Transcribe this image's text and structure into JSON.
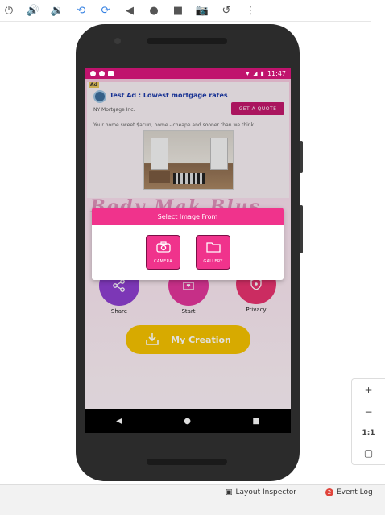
{
  "emulator_toolbar": {
    "items": [
      {
        "icon": "power-icon",
        "glyph": "⏻"
      },
      {
        "icon": "volume-up-icon",
        "glyph": "🔊"
      },
      {
        "icon": "volume-down-icon",
        "glyph": "🔉"
      },
      {
        "icon": "rotate-left-icon",
        "glyph": "⟲"
      },
      {
        "icon": "rotate-right-icon",
        "glyph": "⟳"
      },
      {
        "icon": "back-icon",
        "glyph": "◀"
      },
      {
        "icon": "home-icon",
        "glyph": "●"
      },
      {
        "icon": "overview-icon",
        "glyph": "■"
      },
      {
        "icon": "screenshot-icon",
        "glyph": "📷"
      },
      {
        "icon": "snapshot-icon",
        "glyph": "↺"
      },
      {
        "icon": "more-icon",
        "glyph": "⋮"
      }
    ]
  },
  "status_bar": {
    "time": "11:47"
  },
  "ad": {
    "badge": "Ad",
    "title": "Test Ad : Lowest mortgage rates",
    "company": "NY Mortgage Inc.",
    "cta": "GET A QUOTE",
    "description": "Your home sweet $acun, home - cheape and sooner than we think"
  },
  "app": {
    "title": "Body Mak Blus",
    "menu": [
      {
        "label": "Share",
        "icon": "share-icon"
      },
      {
        "label": "Start",
        "icon": "start-icon"
      },
      {
        "label": "Privacy",
        "icon": "privacy-icon"
      }
    ],
    "creation_label": "My Creation"
  },
  "dialog": {
    "title": "Select Image From",
    "camera_label": "CAMERA",
    "gallery_label": "GALLERY"
  },
  "zoom_panel": {
    "zoom_in": "+",
    "zoom_out": "−",
    "ratio": "1:1"
  },
  "bottom_bar": {
    "layout_inspector": "Layout Inspector",
    "event_log": "Event Log",
    "event_count": "2"
  },
  "colors": {
    "accent": "#f0338c",
    "status_bar": "#c0136d",
    "creation_button": "#f5c200"
  }
}
